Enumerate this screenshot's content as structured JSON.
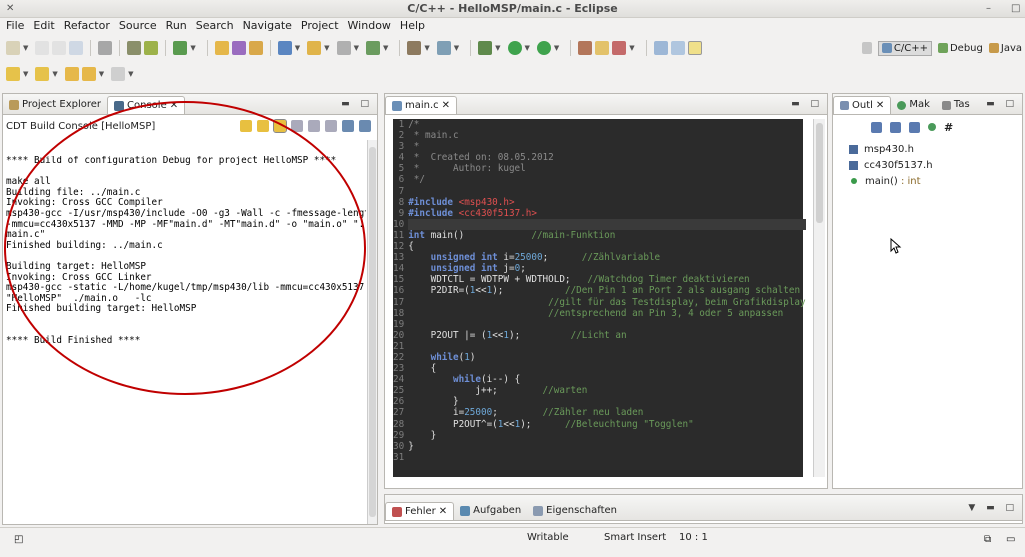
{
  "window": {
    "title": "C/C++ - HelloMSP/main.c - Eclipse"
  },
  "menu": [
    "File",
    "Edit",
    "Refactor",
    "Source",
    "Run",
    "Search",
    "Navigate",
    "Project",
    "Window",
    "Help"
  ],
  "perspectives": [
    "C/C++",
    "Debug",
    "Java"
  ],
  "left_panel": {
    "tabs": [
      "Project Explorer",
      "Console"
    ],
    "console_title": "CDT Build Console [HelloMSP]",
    "console_lines": [
      "**** Build of configuration Debug for project HelloMSP ****",
      "",
      "make all",
      "Building file: ../main.c",
      "Invoking: Cross GCC Compiler",
      "msp430-gcc -I/usr/msp430/include -O0 -g3 -Wall -c -fmessage-length=0",
      "-mmcu=cc430x5137 -MMD -MP -MF\"main.d\" -MT\"main.d\" -o \"main.o\" \"../",
      "main.c\"",
      "Finished building: ../main.c",
      "",
      "Building target: HelloMSP",
      "Invoking: Cross GCC Linker",
      "msp430-gcc -static -L/home/kugel/tmp/msp430/lib -mmcu=cc430x5137 -o",
      "\"HelloMSP\"  ./main.o   -lc",
      "Finished building target: HelloMSP",
      "",
      "",
      "**** Build Finished ****"
    ]
  },
  "editor": {
    "tab": "main.c",
    "lines": [
      {
        "n": "1",
        "t": "/*"
      },
      {
        "n": "2",
        "t": " * main.c"
      },
      {
        "n": "3",
        "t": " *"
      },
      {
        "n": "4",
        "t": " *  Created on: 08.05.2012"
      },
      {
        "n": "5",
        "t": " *      Author: kugel"
      },
      {
        "n": "6",
        "t": " */"
      },
      {
        "n": "7",
        "t": ""
      },
      {
        "n": "8",
        "t": "#include <msp430.h>"
      },
      {
        "n": "9",
        "t": "#include <cc430f5137.h>"
      },
      {
        "n": "10",
        "t": ""
      },
      {
        "n": "11",
        "t": "int main()            //main-Funktion"
      },
      {
        "n": "12",
        "t": "{"
      },
      {
        "n": "13",
        "t": "    unsigned int i=25000;      //Zählvariable"
      },
      {
        "n": "14",
        "t": "    unsigned int j=0;"
      },
      {
        "n": "15",
        "t": "    WDTCTL = WDTPW + WDTHOLD;   //Watchdog Timer deaktivieren"
      },
      {
        "n": "16",
        "t": "    P2DIR=(1<<1);           //Den Pin 1 an Port 2 als ausgang schalten"
      },
      {
        "n": "17",
        "t": "                         //gilt für das Testdisplay, beim Grafikdisplay"
      },
      {
        "n": "18",
        "t": "                         //entsprechend an Pin 3, 4 oder 5 anpassen"
      },
      {
        "n": "19",
        "t": ""
      },
      {
        "n": "20",
        "t": "    P2OUT |= (1<<1);         //Licht an"
      },
      {
        "n": "21",
        "t": ""
      },
      {
        "n": "22",
        "t": "    while(1)"
      },
      {
        "n": "23",
        "t": "    {"
      },
      {
        "n": "24",
        "t": "        while(i--) {"
      },
      {
        "n": "25",
        "t": "            j++;        //warten"
      },
      {
        "n": "26",
        "t": "        }"
      },
      {
        "n": "27",
        "t": "        i=25000;        //Zähler neu laden"
      },
      {
        "n": "28",
        "t": "        P2OUT^=(1<<1);      //Beleuchtung \"Togglen\""
      },
      {
        "n": "29",
        "t": "    }"
      },
      {
        "n": "30",
        "t": "}"
      },
      {
        "n": "31",
        "t": ""
      }
    ]
  },
  "outline": {
    "tabs": [
      "Outl",
      "Mak",
      "Tas"
    ],
    "items": [
      {
        "label": "msp430.h",
        "type": "include"
      },
      {
        "label": "cc430f5137.h",
        "type": "include"
      },
      {
        "label": "main() : int",
        "type": "function"
      }
    ]
  },
  "bottom_tabs": [
    "Fehler",
    "Aufgaben",
    "Eigenschaften"
  ],
  "status": {
    "writable": "Writable",
    "insert": "Smart Insert",
    "position": "10 : 1"
  }
}
